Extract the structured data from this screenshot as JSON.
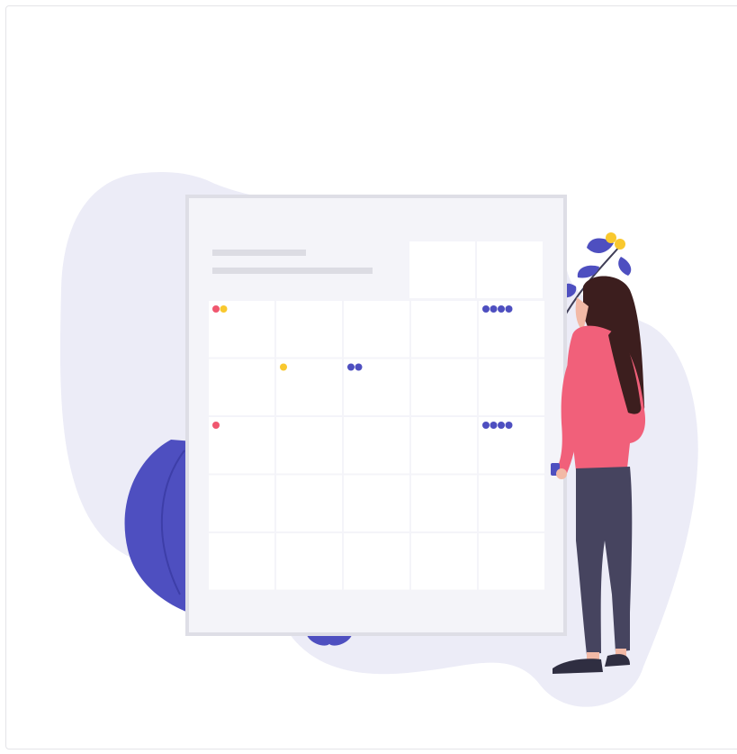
{
  "illustration": {
    "subject": "calendar-with-woman",
    "colors": {
      "blob": "#ececf7",
      "board": "#f4f4f9",
      "board_border": "#dedee6",
      "cell": "#ffffff",
      "grid_line": "#e6e6ec",
      "placeholder_bar": "#dcdce3",
      "accent_blue": "#4e4fc0",
      "accent_yellow": "#f9c82e",
      "accent_pink": "#f0576f",
      "shirt": "#f1607a",
      "pants": "#46445f",
      "hair": "#3c1e1e",
      "skin": "#f2b9a6",
      "shoes": "#2f2e41"
    },
    "calendar": {
      "rows": 5,
      "columns": 5,
      "events": [
        {
          "row": 0,
          "col": 0,
          "dots": [
            "pink",
            "yellow"
          ]
        },
        {
          "row": 0,
          "col": 4,
          "dots": [
            "blue",
            "blue",
            "blue",
            "blue"
          ]
        },
        {
          "row": 1,
          "col": 1,
          "dots": [
            "yellow"
          ]
        },
        {
          "row": 1,
          "col": 2,
          "dots": [
            "blue",
            "blue"
          ]
        },
        {
          "row": 2,
          "col": 0,
          "dots": [
            "pink"
          ]
        },
        {
          "row": 2,
          "col": 4,
          "dots": [
            "blue",
            "blue",
            "blue",
            "blue"
          ]
        }
      ]
    }
  }
}
